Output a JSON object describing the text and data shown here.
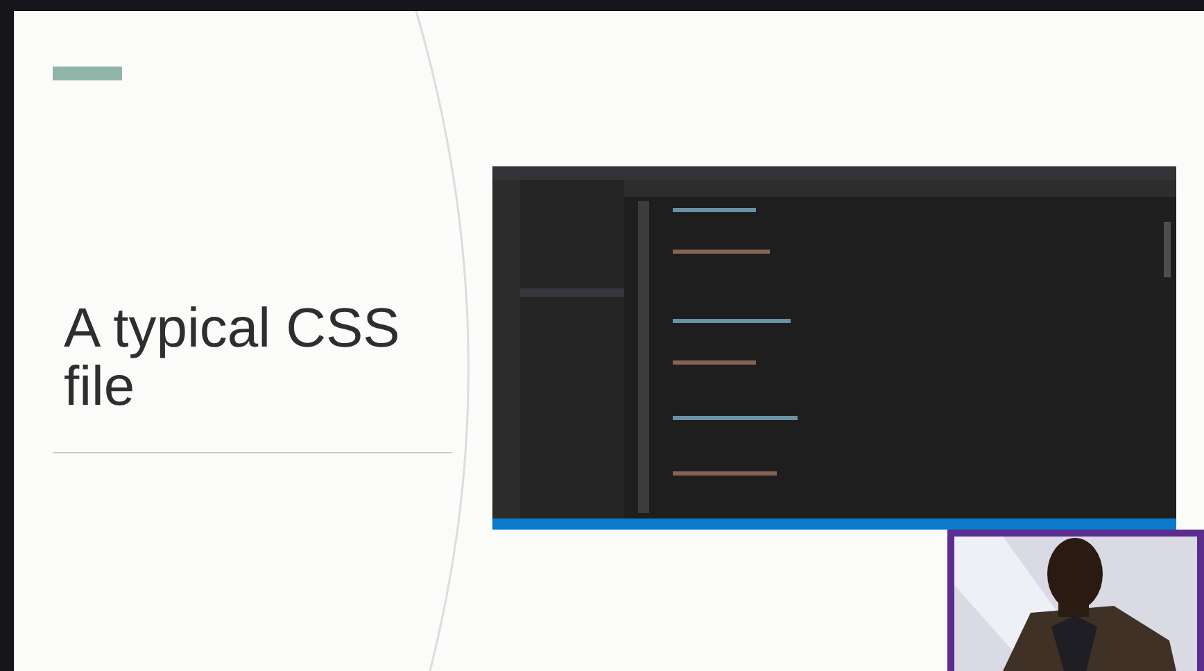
{
  "slide": {
    "title": "A typical CSS file"
  }
}
